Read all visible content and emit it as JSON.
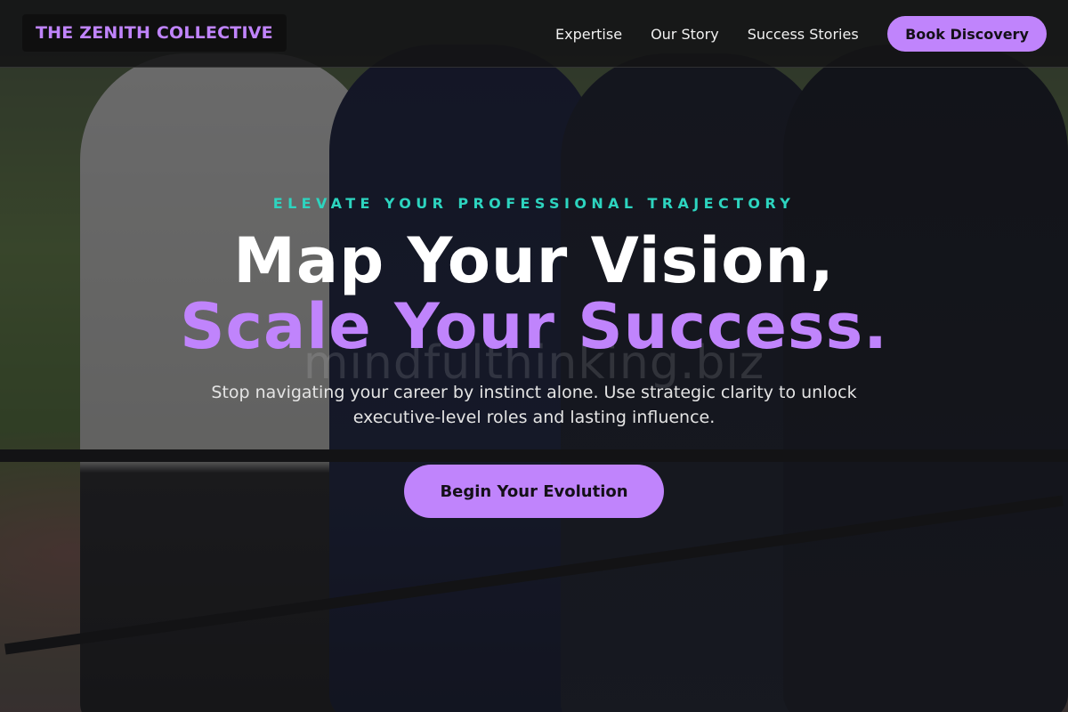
{
  "nav": {
    "brand": "THE ZENITH COLLECTIVE",
    "links": [
      "Expertise",
      "Our Story",
      "Success Stories"
    ],
    "cta_label": "Book Discovery"
  },
  "hero": {
    "eyebrow": "ELEVATE YOUR PROFESSIONAL TRAJECTORY",
    "headline_line1": "Map Your Vision,",
    "headline_line2": "Scale Your Success.",
    "subtext": "Stop navigating your career by instinct alone. Use strategic clarity to unlock executive-level roles and lasting influence.",
    "cta_label": "Begin Your Evolution",
    "background_watermark": "mindfulthinking.biz"
  },
  "colors": {
    "accent": "#c084fc",
    "eyebrow": "#2dd4bf",
    "nav_background": "#141416"
  }
}
